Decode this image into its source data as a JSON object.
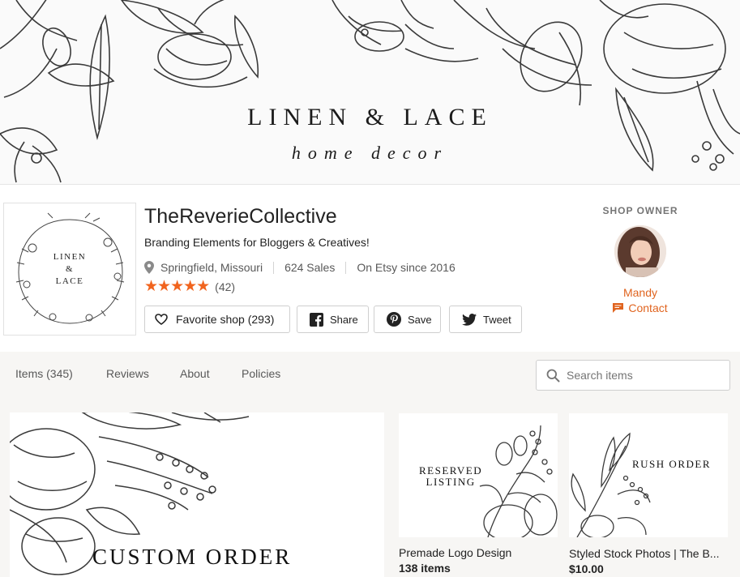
{
  "banner": {
    "title": "LINEN & LACE",
    "subtitle": "home decor"
  },
  "logo": {
    "line1": "LINEN",
    "line2": "&",
    "line3": "LACE"
  },
  "shop": {
    "name": "TheReverieCollective",
    "tagline": "Branding Elements for Bloggers & Creatives!",
    "location": "Springfield, Missouri",
    "sales": "624 Sales",
    "since": "On Etsy since 2016",
    "stars": "★★★★★",
    "rating_count": "(42)"
  },
  "actions": {
    "favorite": "Favorite shop (293)",
    "share": "Share",
    "save": "Save",
    "tweet": "Tweet"
  },
  "owner": {
    "label": "SHOP OWNER",
    "name": "Mandy",
    "contact": "Contact"
  },
  "nav": {
    "tabs": [
      {
        "label": "Items (345)"
      },
      {
        "label": "Reviews"
      },
      {
        "label": "About"
      },
      {
        "label": "Policies"
      }
    ],
    "search_placeholder": "Search items"
  },
  "listings": {
    "featured": {
      "image_text": "CUSTOM ORDER"
    },
    "items": [
      {
        "image_line1": "RESERVED",
        "image_line2": "LISTING",
        "title": "Premade Logo Design",
        "sub": "138 items"
      },
      {
        "image_line1": "RUSH ORDER",
        "title": "Styled Stock Photos | The B...",
        "sub": "$10.00"
      }
    ]
  },
  "colors": {
    "accent": "#e0641f",
    "star": "#f1641e",
    "strip_bg": "#f7f6f4"
  }
}
